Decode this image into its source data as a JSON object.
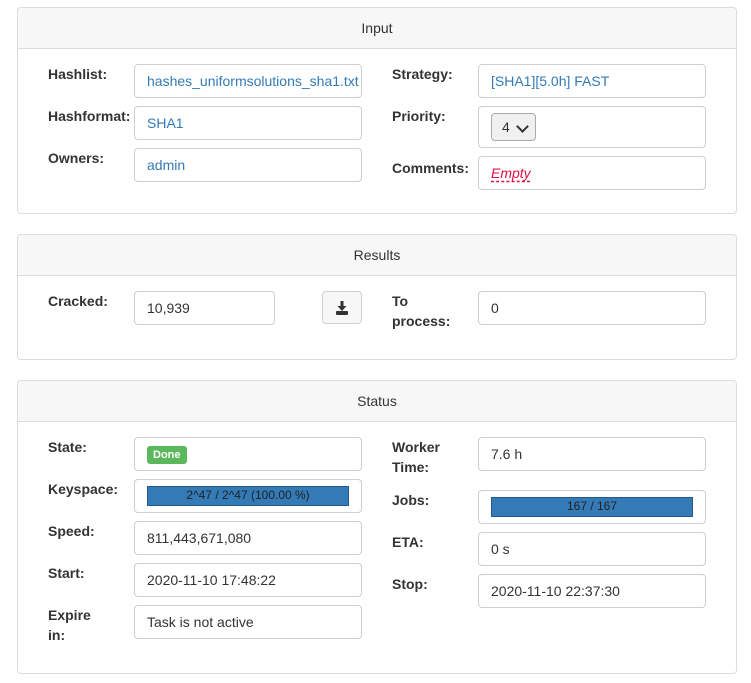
{
  "input": {
    "title": "Input",
    "hashlist_label": "Hashlist:",
    "hashlist": "hashes_uniformsolutions_sha1.txt",
    "hashformat_label": "Hashformat:",
    "hashformat": "SHA1",
    "owners_label": "Owners:",
    "owners": "admin",
    "strategy_label": "Strategy:",
    "strategy": "[SHA1][5.0h] FAST",
    "priority_label": "Priority:",
    "priority": "4",
    "comments_label": "Comments:",
    "comments": "Empty"
  },
  "results": {
    "title": "Results",
    "cracked_label": "Cracked:",
    "cracked": "10,939",
    "to_process_label_1": "To",
    "to_process_label_2": "process:",
    "to_process": "0"
  },
  "status": {
    "title": "Status",
    "state_label": "State:",
    "state": "Done",
    "state_color": "#5cb85c",
    "keyspace_label": "Keyspace:",
    "keyspace_text": "2^47 / 2^47 (100.00 %)",
    "keyspace_progress": 100,
    "speed_label": "Speed:",
    "speed": "811,443,671,080",
    "start_label": "Start:",
    "start": "2020-11-10 17:48:22",
    "expire_label_1": "Expire",
    "expire_label_2": "in:",
    "expire": "Task is not active",
    "worker_time_label_1": "Worker",
    "worker_time_label_2": "Time:",
    "worker_time": "7.6 h",
    "jobs_label": "Jobs:",
    "jobs_text": "167 / 167",
    "jobs_progress": 100,
    "eta_label": "ETA:",
    "eta": "0 s",
    "stop_label": "Stop:",
    "stop": "2020-11-10 22:37:30"
  },
  "icons": {
    "download": "download-icon",
    "dropdown": "chevron-down-icon"
  },
  "colors": {
    "link": "#337ab7",
    "progress": "#337ab7",
    "empty": "#dd1144"
  }
}
